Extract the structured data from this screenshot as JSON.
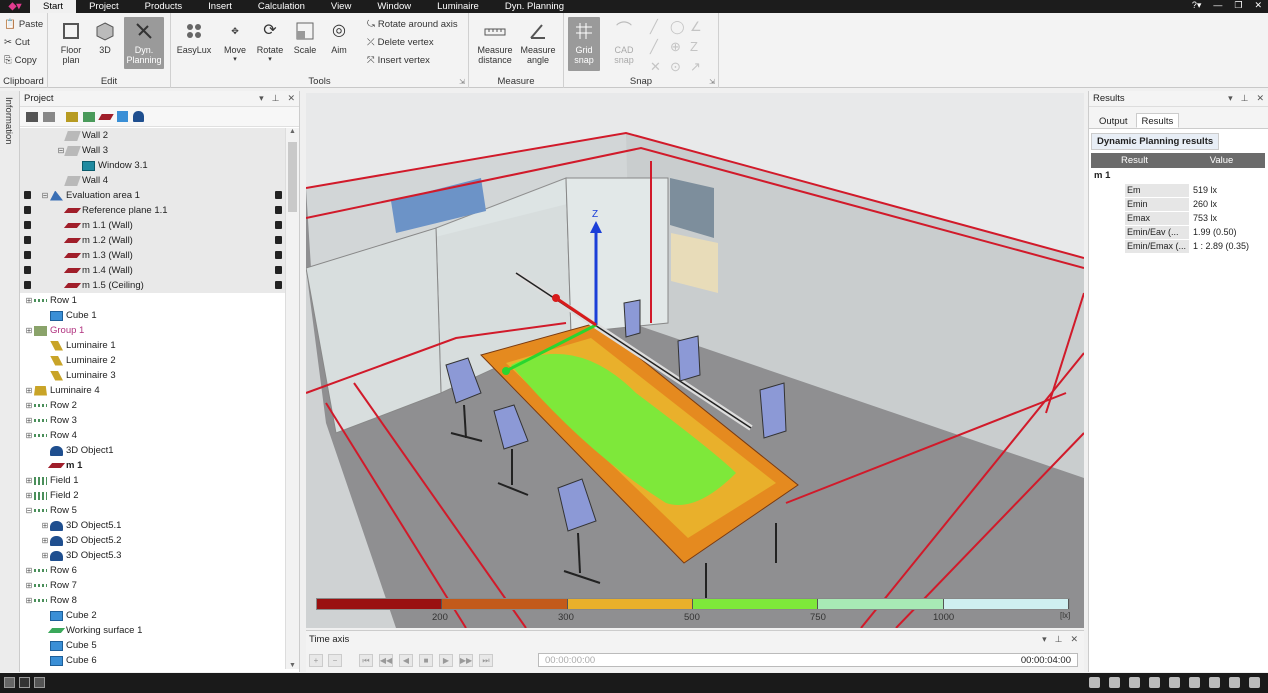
{
  "menubar": {
    "items": [
      {
        "label": "Start",
        "active": true
      },
      {
        "label": "Project"
      },
      {
        "label": "Products"
      },
      {
        "label": "Insert"
      },
      {
        "label": "Calculation"
      },
      {
        "label": "View"
      },
      {
        "label": "Window"
      },
      {
        "label": "Luminaire"
      },
      {
        "label": "Dyn. Planning"
      }
    ]
  },
  "ribbon": {
    "clipboard": {
      "label": "Clipboard",
      "paste": "Paste",
      "cut": "Cut",
      "copy": "Copy"
    },
    "edit": {
      "label": "Edit",
      "floor_plan": "Floor plan",
      "three_d": "3D",
      "dyn_planning": "Dyn. Planning"
    },
    "tools": {
      "label": "Tools",
      "easylux": "EasyLux",
      "move": "Move",
      "rotate": "Rotate",
      "scale": "Scale",
      "aim": "Aim",
      "rotate_axis": "Rotate around axis",
      "delete_vertex": "Delete vertex",
      "insert_vertex": "Insert vertex"
    },
    "measure": {
      "label": "Measure",
      "distance": "Measure distance",
      "angle": "Measure angle"
    },
    "snap": {
      "label": "Snap",
      "grid": "Grid snap",
      "cad": "CAD snap"
    }
  },
  "sidebar": {
    "tab": "Information"
  },
  "project": {
    "title": "Project",
    "tree": [
      {
        "label": "Wall 2",
        "indent": 2,
        "toggle": "",
        "icon": "wall",
        "bg": "gray"
      },
      {
        "label": "Wall 3",
        "indent": 2,
        "toggle": "−",
        "icon": "wall",
        "bg": "gray"
      },
      {
        "label": "Window 3.1",
        "indent": 3,
        "toggle": "",
        "icon": "window",
        "bg": "gray"
      },
      {
        "label": "Wall 4",
        "indent": 2,
        "toggle": "",
        "icon": "wall",
        "bg": "gray"
      },
      {
        "label": "Evaluation area 1",
        "indent": 1,
        "toggle": "−",
        "icon": "area",
        "bg": "gray",
        "lock": true
      },
      {
        "label": "Reference plane 1.1",
        "indent": 2,
        "toggle": "",
        "icon": "plane",
        "bg": "gray",
        "lock": true
      },
      {
        "label": "m 1.1 (Wall)",
        "indent": 2,
        "toggle": "",
        "icon": "plane",
        "bg": "gray",
        "lock": true
      },
      {
        "label": "m 1.2 (Wall)",
        "indent": 2,
        "toggle": "",
        "icon": "plane",
        "bg": "gray",
        "lock": true
      },
      {
        "label": "m 1.3 (Wall)",
        "indent": 2,
        "toggle": "",
        "icon": "plane",
        "bg": "gray",
        "lock": true
      },
      {
        "label": "m 1.4 (Wall)",
        "indent": 2,
        "toggle": "",
        "icon": "plane",
        "bg": "gray",
        "lock": true
      },
      {
        "label": "m 1.5 (Ceiling)",
        "indent": 2,
        "toggle": "",
        "icon": "plane",
        "bg": "gray",
        "lock": true
      },
      {
        "label": "Row  1",
        "indent": 0,
        "toggle": "+",
        "icon": "row"
      },
      {
        "label": "Cube 1",
        "indent": 1,
        "toggle": "",
        "icon": "cube"
      },
      {
        "label": "Group  1",
        "indent": 0,
        "toggle": "+",
        "icon": "group",
        "color": "#b0307e"
      },
      {
        "label": "Luminaire 1",
        "indent": 1,
        "toggle": "",
        "icon": "lum"
      },
      {
        "label": "Luminaire 2",
        "indent": 1,
        "toggle": "",
        "icon": "lum"
      },
      {
        "label": "Luminaire 3",
        "indent": 1,
        "toggle": "",
        "icon": "lum"
      },
      {
        "label": "Luminaire  4",
        "indent": 0,
        "toggle": "+",
        "icon": "lum4"
      },
      {
        "label": "Row  2",
        "indent": 0,
        "toggle": "+",
        "icon": "row"
      },
      {
        "label": "Row  3",
        "indent": 0,
        "toggle": "+",
        "icon": "row"
      },
      {
        "label": "Row  4",
        "indent": 0,
        "toggle": "+",
        "icon": "row"
      },
      {
        "label": "3D Object1",
        "indent": 1,
        "toggle": "",
        "icon": "obj"
      },
      {
        "label": "m 1",
        "indent": 1,
        "toggle": "",
        "icon": "plane",
        "bold": true
      },
      {
        "label": "Field 1",
        "indent": 0,
        "toggle": "+",
        "icon": "field"
      },
      {
        "label": "Field 2",
        "indent": 0,
        "toggle": "+",
        "icon": "field"
      },
      {
        "label": "Row  5",
        "indent": 0,
        "toggle": "−",
        "icon": "row"
      },
      {
        "label": "3D Object5.1",
        "indent": 1,
        "toggle": "+",
        "icon": "obj"
      },
      {
        "label": "3D Object5.2",
        "indent": 1,
        "toggle": "+",
        "icon": "obj"
      },
      {
        "label": "3D Object5.3",
        "indent": 1,
        "toggle": "+",
        "icon": "obj"
      },
      {
        "label": "Row  6",
        "indent": 0,
        "toggle": "+",
        "icon": "row"
      },
      {
        "label": "Row  7",
        "indent": 0,
        "toggle": "+",
        "icon": "row"
      },
      {
        "label": "Row  8",
        "indent": 0,
        "toggle": "+",
        "icon": "row"
      },
      {
        "label": "Cube 2",
        "indent": 1,
        "toggle": "",
        "icon": "cube"
      },
      {
        "label": "Working surface 1",
        "indent": 1,
        "toggle": "",
        "icon": "ws"
      },
      {
        "label": "Cube 5",
        "indent": 1,
        "toggle": "",
        "icon": "cube"
      },
      {
        "label": "Cube 6",
        "indent": 1,
        "toggle": "",
        "icon": "cube"
      }
    ]
  },
  "viewport": {
    "axis_z": "Z"
  },
  "legend": {
    "colors": [
      "#9a1010",
      "#c35a1a",
      "#e9b02b",
      "#7ee83a",
      "#a8eab5",
      "#cfeff0"
    ],
    "ticks": [
      "200",
      "300",
      "500",
      "750",
      "1000"
    ],
    "unit": "[lx]"
  },
  "timeaxis": {
    "title": "Time axis",
    "start": "00:00:00:00",
    "end": "00:00:04:00"
  },
  "results": {
    "title": "Results",
    "tabs": [
      "Output",
      "Results"
    ],
    "section": "Dynamic Planning results",
    "col_result": "Result",
    "col_value": "Value",
    "group": "m 1",
    "rows": [
      {
        "k": "Em",
        "v": "519 lx"
      },
      {
        "k": "Emin",
        "v": "260 lx"
      },
      {
        "k": "Emax",
        "v": "753 lx"
      },
      {
        "k": "Emin/Eav (...",
        "v": "1.99 (0.50)"
      },
      {
        "k": "Emin/Emax (...",
        "v": "1 : 2.89 (0.35)"
      }
    ]
  }
}
